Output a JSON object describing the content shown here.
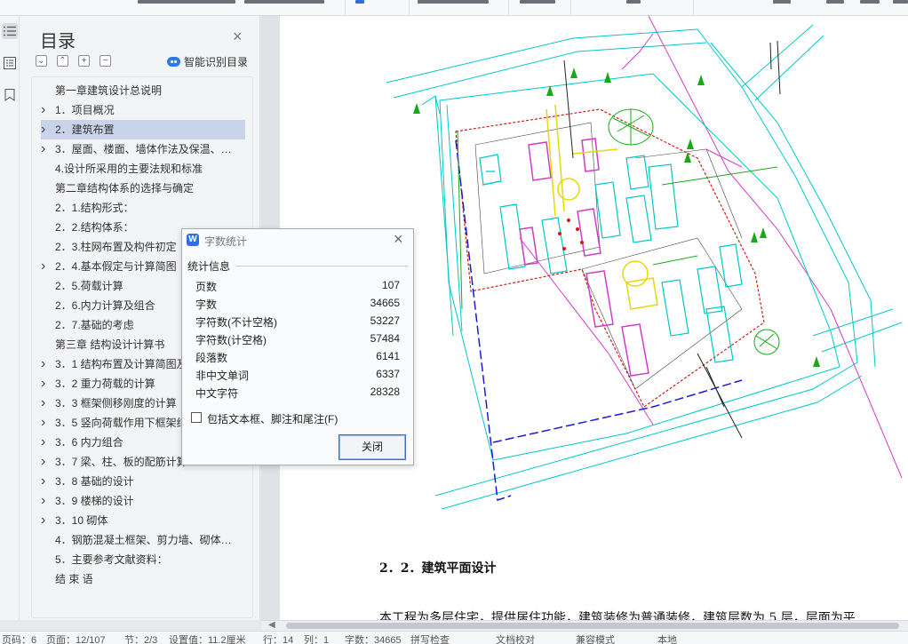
{
  "toc": {
    "title": "目录",
    "smart_label": "智能识别目录",
    "items": [
      {
        "label": "第一章建筑设计总说明",
        "indent": 0,
        "arrow": false
      },
      {
        "label": "1．项目概况",
        "indent": 1,
        "arrow": true
      },
      {
        "label": "2．建筑布置",
        "indent": 1,
        "arrow": true,
        "selected": true
      },
      {
        "label": "3．屋面、楼面、墙体作法及保温、…",
        "indent": 1,
        "arrow": true
      },
      {
        "label": "4.设计所采用的主要法规和标准",
        "indent": 1,
        "arrow": false
      },
      {
        "label": "第二章结构体系的选择与确定",
        "indent": 0,
        "arrow": false
      },
      {
        "label": "2．1.结构形式：",
        "indent": 1,
        "arrow": false
      },
      {
        "label": "2．2.结构体系：",
        "indent": 1,
        "arrow": false
      },
      {
        "label": "2．3.柱网布置及构件初定",
        "indent": 1,
        "arrow": false
      },
      {
        "label": "2．4.基本假定与计算简图",
        "indent": 1,
        "arrow": true
      },
      {
        "label": "2．5.荷载计算",
        "indent": 1,
        "arrow": false
      },
      {
        "label": "2．6.内力计算及组合",
        "indent": 1,
        "arrow": false
      },
      {
        "label": "2．7.基础的考虑",
        "indent": 1,
        "arrow": false
      },
      {
        "label": "第三章 结构设计计算书",
        "indent": 0,
        "arrow": false
      },
      {
        "label": "3．1 结构布置及计算简图及",
        "indent": 1,
        "arrow": true
      },
      {
        "label": "3．2 重力荷载的计算",
        "indent": 1,
        "arrow": true
      },
      {
        "label": "3．3 框架侧移刚度的计算",
        "indent": 1,
        "arrow": true
      },
      {
        "label": "3．5 竖向荷载作用下框架结",
        "indent": 1,
        "arrow": true
      },
      {
        "label": "3．6 内力组合",
        "indent": 1,
        "arrow": true
      },
      {
        "label": "3．7 梁、柱、板的配筋计算",
        "indent": 1,
        "arrow": true
      },
      {
        "label": "3．8 基础的设计",
        "indent": 1,
        "arrow": true
      },
      {
        "label": "3．9 楼梯的设计",
        "indent": 1,
        "arrow": true
      },
      {
        "label": "3．10 砌体",
        "indent": 1,
        "arrow": true
      },
      {
        "label": "4．钢筋混凝土框架、剪力墙、砌体…",
        "indent": 1,
        "arrow": false
      },
      {
        "label": "5．主要参考文献资料：",
        "indent": 1,
        "arrow": false
      },
      {
        "label": "结 束 语",
        "indent": 1,
        "arrow": false
      }
    ]
  },
  "document": {
    "heading": "2．2．建筑平面设计",
    "paragraph": "本工程为多层住宅，提供居住功能，建筑装修为普通装修，建筑层数为 5 层，层面为平"
  },
  "dialog": {
    "title": "字数统计",
    "group_label": "统计信息",
    "stats": [
      {
        "label": "页数",
        "value": "107"
      },
      {
        "label": "字数",
        "value": "34665"
      },
      {
        "label": "字符数(不计空格)",
        "value": "53227"
      },
      {
        "label": "字符数(计空格)",
        "value": "57484"
      },
      {
        "label": "段落数",
        "value": "6141"
      },
      {
        "label": "非中文单词",
        "value": "6337"
      },
      {
        "label": "中文字符",
        "value": "28328"
      }
    ],
    "checkbox_label": "包括文本框、脚注和尾注(F)",
    "checkbox_checked": false,
    "close_button": "关闭"
  },
  "status_bar": {
    "items": [
      "页码：6",
      "页面：12/107",
      "节：2/3",
      "设置值：11.2厘米",
      "行：14",
      "列：1",
      "字数：34665",
      "拼写检查",
      "文档校对",
      "兼容模式",
      "本地"
    ]
  },
  "colors": {
    "selection": "#c9d4ea",
    "accent": "#2f6fe0",
    "cad_cyan": "#00c8c8",
    "cad_magenta": "#d23cc8",
    "cad_red": "#d11a1a",
    "cad_blue": "#1a1ad6",
    "cad_green": "#1aa81a",
    "cad_yellow": "#f2e600"
  }
}
